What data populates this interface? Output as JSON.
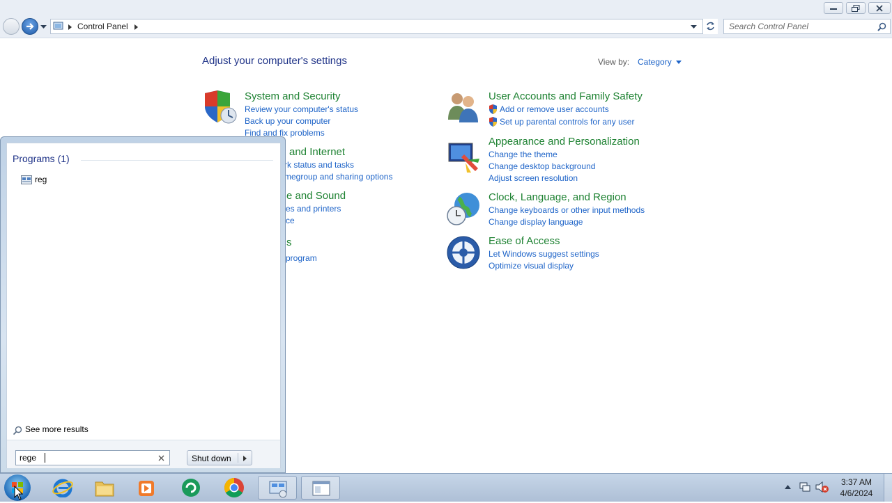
{
  "window": {
    "breadcrumb": [
      "Control Panel"
    ],
    "search_placeholder": "Search Control Panel"
  },
  "control_panel": {
    "heading": "Adjust your computer's settings",
    "view_by_label": "View by:",
    "view_by_value": "Category",
    "left_categories": [
      {
        "title": "System and Security",
        "links": [
          "Review your computer's status",
          "Back up your computer",
          "Find and fix problems"
        ],
        "icon": "shield-icon"
      },
      {
        "title": "and Internet",
        "links": [
          "rk status and tasks",
          "megroup and sharing options"
        ],
        "icon": "network-icon"
      },
      {
        "title": "e and Sound",
        "links": [
          "es and printers",
          "ce"
        ],
        "icon": "sound-icon"
      },
      {
        "title": "s",
        "links": [
          "program"
        ],
        "icon": "programs-icon"
      }
    ],
    "right_categories": [
      {
        "title": "User Accounts and Family Safety",
        "links": [
          "Add or remove user accounts",
          "Set up parental controls for any user"
        ],
        "icon": "users-icon"
      },
      {
        "title": "Appearance and Personalization",
        "links": [
          "Change the theme",
          "Change desktop background",
          "Adjust screen resolution"
        ],
        "icon": "appearance-icon"
      },
      {
        "title": "Clock, Language, and Region",
        "links": [
          "Change keyboards or other input methods",
          "Change display language"
        ],
        "icon": "globe-clock-icon"
      },
      {
        "title": "Ease of Access",
        "links": [
          "Let Windows suggest settings",
          "Optimize visual display"
        ],
        "icon": "ease-of-access-icon"
      }
    ]
  },
  "start_menu": {
    "programs_header": "Programs (1)",
    "results": [
      "reg"
    ],
    "see_more": "See more results",
    "search_value": "rege",
    "shutdown_label": "Shut down"
  },
  "taskbar": {
    "time": "3:37 AM",
    "date": "4/6/2024",
    "pinned": [
      "start-orb",
      "internet-explorer",
      "file-explorer",
      "media-player",
      "greenshot",
      "chrome",
      "control-panel",
      "document-window"
    ]
  },
  "colors": {
    "link": "#1e64c8",
    "category_title": "#1e8232",
    "heading": "#1e3287"
  }
}
